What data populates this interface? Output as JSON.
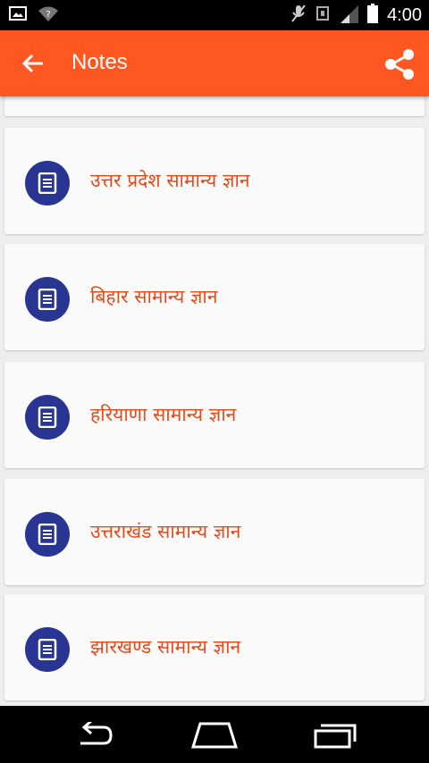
{
  "status_bar": {
    "time": "4:00",
    "icons": [
      "image-notification-icon",
      "wifi-question-icon",
      "mute-icon",
      "nfc-icon",
      "signal-icon",
      "battery-icon"
    ]
  },
  "app_bar": {
    "title": "Notes",
    "back_icon": "arrow-back-icon",
    "share_icon": "share-icon",
    "background": "#ff5722"
  },
  "notes": [
    {
      "label": "उत्तर प्रदेश सामान्य ज्ञान",
      "icon": "note-icon"
    },
    {
      "label": "बिहार सामान्य ज्ञान",
      "icon": "note-icon"
    },
    {
      "label": "हरियाणा सामान्य ज्ञान",
      "icon": "note-icon"
    },
    {
      "label": "उत्तराखंड सामान्य ज्ञान",
      "icon": "note-icon"
    },
    {
      "label": "झारखण्ड सामान्य ज्ञान",
      "icon": "note-icon"
    }
  ],
  "colors": {
    "accent": "#ff5722",
    "label_text": "#e64a19",
    "icon_circle": "#283593",
    "card": "#fafafa",
    "background": "#eeeeee"
  },
  "nav_bar": {
    "buttons": [
      "back-nav-icon",
      "home-nav-icon",
      "recents-nav-icon"
    ]
  }
}
